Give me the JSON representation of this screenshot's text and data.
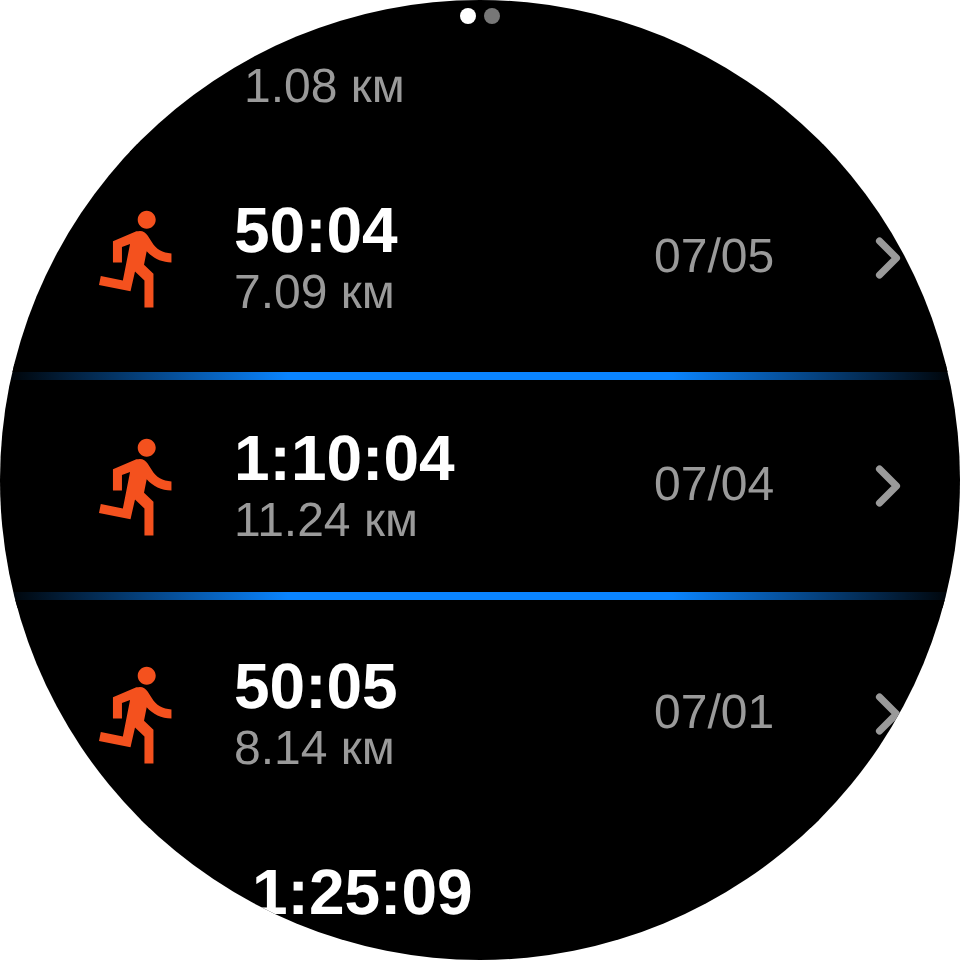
{
  "pager": [
    {
      "selected": true
    },
    {
      "selected": false
    }
  ],
  "top_partial": {
    "distance": "1.08 км"
  },
  "workouts": [
    {
      "time": "50:04",
      "distance": "7.09 км",
      "date": "07/05",
      "selected": false
    },
    {
      "time": "1:10:04",
      "distance": "11.24 км",
      "date": "07/04",
      "selected": true
    },
    {
      "time": "50:05",
      "distance": "8.14 км",
      "date": "07/01",
      "selected": false
    }
  ],
  "bottom_partial": {
    "time": "1:25:09"
  }
}
